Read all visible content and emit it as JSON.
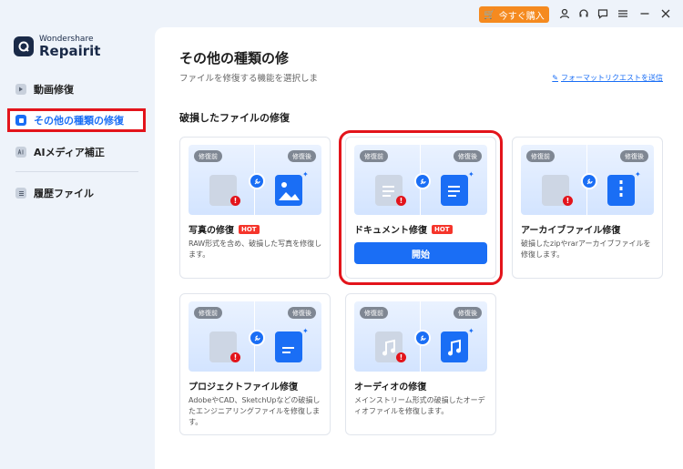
{
  "topbar": {
    "buy_label": "今すぐ購入",
    "icons": [
      "user-icon",
      "headset-icon",
      "chat-icon",
      "menu-icon",
      "minimize-icon",
      "close-icon"
    ]
  },
  "brand": {
    "line1": "Wondershare",
    "line2": "Repairit"
  },
  "sidebar": {
    "items": [
      {
        "label": "動画修復"
      },
      {
        "label": "その他の種類の修復"
      },
      {
        "label": "AIメディア補正"
      },
      {
        "label": "履歴ファイル"
      }
    ]
  },
  "main": {
    "title": "その他の種類の修",
    "subtitle": "ファイルを修復する機能を選択しま",
    "request_link": "フォーマットリクエストを送信",
    "section_title": "破損したファイルの修復",
    "badge_before": "修復前",
    "badge_after": "修復後",
    "hot": "HOT",
    "start": "開始",
    "cards": [
      {
        "title": "写真の修復",
        "desc": "RAW形式を含め、破損した写真を修復します。"
      },
      {
        "title": "ドキュメント修復"
      },
      {
        "title": "アーカイブファイル修復",
        "desc": "破損したzipやrarアーカイブファイルを修復します。"
      },
      {
        "title": "プロジェクトファイル修復",
        "desc": "AdobeやCAD、SketchUpなどの破損したエンジニアリングファイルを修復します。"
      },
      {
        "title": "オーディオの修復",
        "desc": "メインストリーム形式の破損したオーディオファイルを修復します。"
      }
    ]
  }
}
